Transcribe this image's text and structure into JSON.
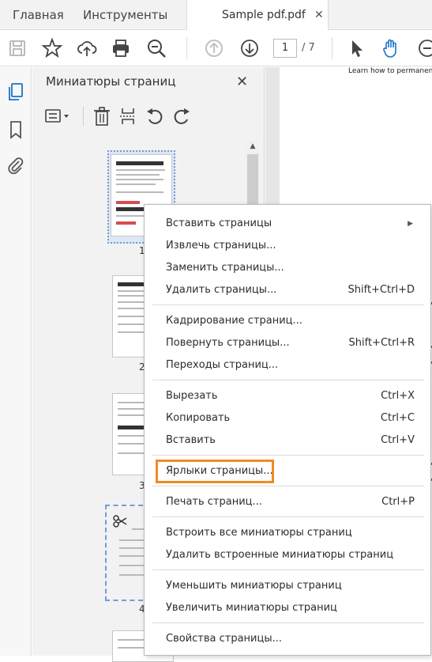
{
  "tabs": {
    "home": "Главная",
    "tools": "Инструменты",
    "document": "Sample pdf.pdf",
    "close": "✕"
  },
  "toolbar": {
    "current_page": "1",
    "total_pages": "/ 7",
    "icons": [
      "save-icon",
      "star-icon",
      "cloud-upload-icon",
      "print-icon",
      "zoom-out-icon",
      "page-up-icon",
      "page-down-icon",
      "select-arrow-icon",
      "hand-icon",
      "zoom-minus-icon"
    ]
  },
  "panel": {
    "title": "Миниатюры страниц",
    "close": "✕",
    "page_numbers": [
      "1",
      "2",
      "3",
      "4"
    ]
  },
  "document": {
    "visible_text": "Learn how to permanently re"
  },
  "context_menu": {
    "items": [
      {
        "label": "Вставить страницы",
        "shortcut": "",
        "submenu": "▶"
      },
      {
        "label": "Извлечь страницы...",
        "shortcut": ""
      },
      {
        "label": "Заменить страницы...",
        "shortcut": ""
      },
      {
        "label": "Удалить страницы...",
        "shortcut": "Shift+Ctrl+D"
      },
      {
        "label": "Кадрирование страниц...",
        "shortcut": ""
      },
      {
        "label": "Повернуть страницы...",
        "shortcut": "Shift+Ctrl+R"
      },
      {
        "label": "Переходы страниц...",
        "shortcut": ""
      },
      {
        "label": "Вырезать",
        "shortcut": "Ctrl+X"
      },
      {
        "label": "Копировать",
        "shortcut": "Ctrl+C"
      },
      {
        "label": "Вставить",
        "shortcut": "Ctrl+V"
      },
      {
        "label": "Ярлыки страницы...",
        "shortcut": ""
      },
      {
        "label": "Печать страниц...",
        "shortcut": "Ctrl+P"
      },
      {
        "label": "Встроить все миниатюры страниц",
        "shortcut": ""
      },
      {
        "label": "Удалить встроенные миниатюры страниц",
        "shortcut": ""
      },
      {
        "label": "Уменьшить миниатюры страниц",
        "shortcut": ""
      },
      {
        "label": "Увеличить миниатюры страниц",
        "shortcut": ""
      },
      {
        "label": "Свойства страницы...",
        "shortcut": ""
      }
    ]
  },
  "colors": {
    "highlight": "#f08a24",
    "selection": "#7a9ad0"
  }
}
